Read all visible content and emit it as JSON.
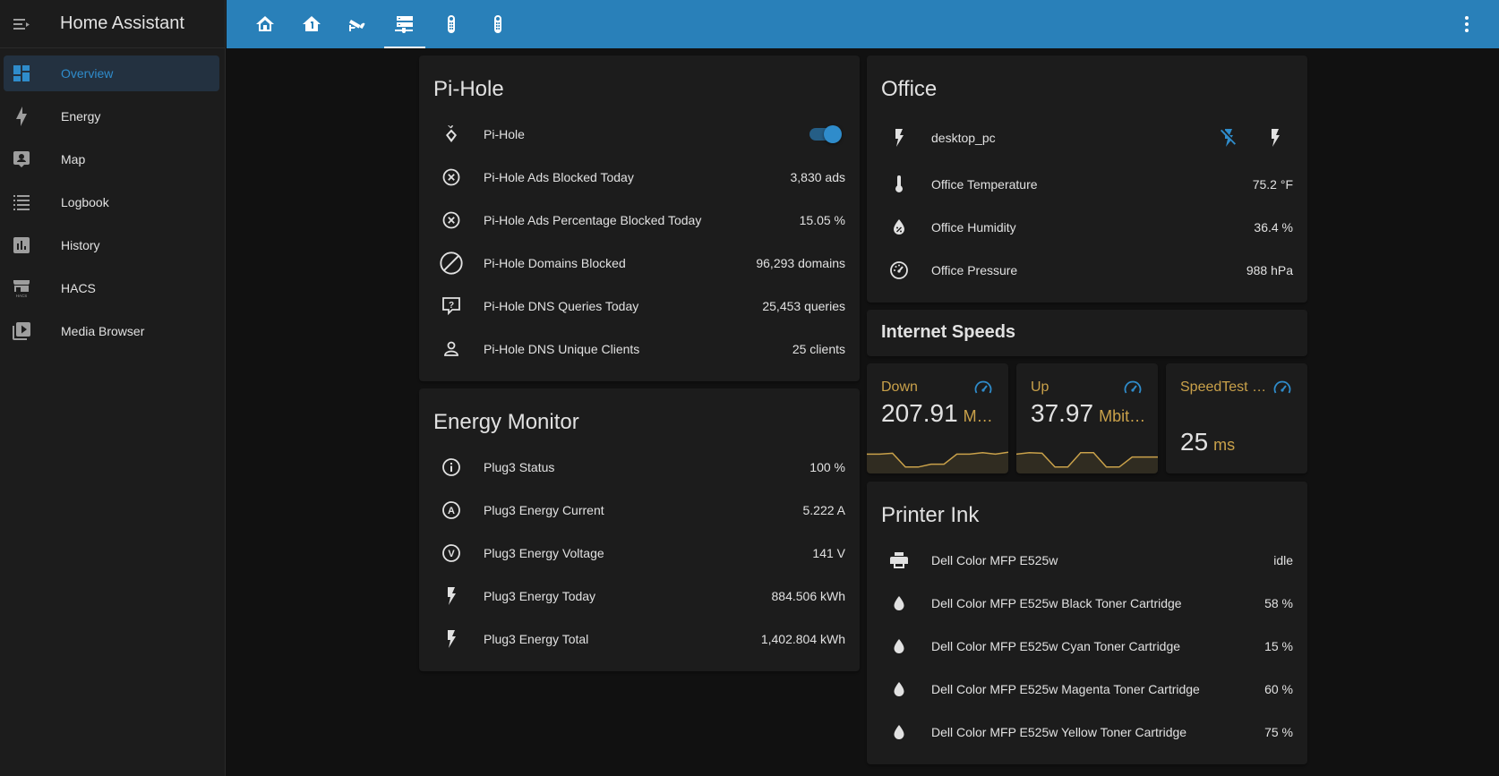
{
  "app": {
    "title": "Home Assistant"
  },
  "sidebar": {
    "items": [
      {
        "label": "Overview",
        "icon": "view-dashboard-icon",
        "active": true
      },
      {
        "label": "Energy",
        "icon": "lightning-bolt-icon"
      },
      {
        "label": "Map",
        "icon": "account-box-icon"
      },
      {
        "label": "Logbook",
        "icon": "format-list-bulleted-icon"
      },
      {
        "label": "History",
        "icon": "chart-box-icon"
      },
      {
        "label": "HACS",
        "icon": "hacs-icon"
      },
      {
        "label": "Media Browser",
        "icon": "play-box-multiple-icon"
      }
    ]
  },
  "topbar": {
    "tabs": [
      {
        "icon": "home-icon"
      },
      {
        "icon": "home-floor-1-icon"
      },
      {
        "icon": "cctv-icon"
      },
      {
        "icon": "server-network-icon",
        "active": true
      },
      {
        "icon": "remote-icon"
      },
      {
        "icon": "remote-icon"
      }
    ],
    "menu_icon": "dots-vertical-icon"
  },
  "pihole": {
    "title": "Pi-Hole",
    "rows": [
      {
        "name": "Pi-Hole",
        "value": "",
        "icon": "pi-hole-icon",
        "toggle_on": true
      },
      {
        "name": "Pi-Hole Ads Blocked Today",
        "value": "3,830 ads",
        "icon": "close-circle-outline-icon"
      },
      {
        "name": "Pi-Hole Ads Percentage Blocked Today",
        "value": "15.05 %",
        "icon": "close-circle-outline-icon"
      },
      {
        "name": "Pi-Hole Domains Blocked",
        "value": "96,293 domains",
        "icon": "block-helper-icon"
      },
      {
        "name": "Pi-Hole DNS Queries Today",
        "value": "25,453 queries",
        "icon": "comment-question-outline-icon"
      },
      {
        "name": "Pi-Hole DNS Unique Clients",
        "value": "25 clients",
        "icon": "account-outline-icon"
      }
    ]
  },
  "energy_monitor": {
    "title": "Energy Monitor",
    "rows": [
      {
        "name": "Plug3 Status",
        "value": "100 %",
        "icon": "information-outline-icon"
      },
      {
        "name": "Plug3 Energy Current",
        "value": "5.222 A",
        "icon": "alpha-a-circle-outline-icon"
      },
      {
        "name": "Plug3 Energy Voltage",
        "value": "141 V",
        "icon": "alpha-v-circle-outline-icon"
      },
      {
        "name": "Plug3 Energy Today",
        "value": "884.506 kWh",
        "icon": "flash-icon"
      },
      {
        "name": "Plug3 Energy Total",
        "value": "1,402.804 kWh",
        "icon": "flash-icon"
      }
    ]
  },
  "office": {
    "title": "Office",
    "rows": [
      {
        "name": "desktop_pc",
        "value": "",
        "icon": "flash-icon",
        "actions": [
          "flash-off-icon",
          "flash-icon"
        ]
      },
      {
        "name": "Office Temperature",
        "value": "75.2 °F",
        "icon": "thermometer-icon"
      },
      {
        "name": "Office Humidity",
        "value": "36.4 %",
        "icon": "water-percent-icon"
      },
      {
        "name": "Office Pressure",
        "value": "988 hPa",
        "icon": "gauge-icon"
      }
    ]
  },
  "internet_speeds": {
    "title": "Internet Speeds",
    "stats": [
      {
        "name": "Down",
        "value": "207.91",
        "unit": "M…",
        "icon": "speedometer-icon",
        "spark": [
          0.55,
          0.55,
          0.58,
          0.1,
          0.1,
          0.2,
          0.2,
          0.55,
          0.55,
          0.6,
          0.55,
          0.62
        ]
      },
      {
        "name": "Up",
        "value": "37.97",
        "unit": "Mbit…",
        "icon": "speedometer-icon",
        "spark": [
          0.55,
          0.6,
          0.58,
          0.1,
          0.1,
          0.6,
          0.6,
          0.1,
          0.1,
          0.45,
          0.45,
          0.45
        ]
      },
      {
        "name": "SpeedTest P…",
        "value": "25",
        "unit": "ms",
        "icon": "speedometer-icon",
        "spark": []
      }
    ]
  },
  "printer_ink": {
    "title": "Printer Ink",
    "rows": [
      {
        "name": "Dell Color MFP E525w",
        "value": "idle",
        "icon": "printer-icon"
      },
      {
        "name": "Dell Color MFP E525w Black Toner Cartridge",
        "value": "58 %",
        "icon": "water-icon"
      },
      {
        "name": "Dell Color MFP E525w Cyan Toner Cartridge",
        "value": "15 %",
        "icon": "water-icon"
      },
      {
        "name": "Dell Color MFP E525w Magenta Toner Cartridge",
        "value": "60 %",
        "icon": "water-icon"
      },
      {
        "name": "Dell Color MFP E525w Yellow Toner Cartridge",
        "value": "75 %",
        "icon": "water-icon"
      }
    ]
  },
  "colors": {
    "accent": "#2980b9",
    "active_text": "#2f8ccb",
    "stat_gold": "#c9a14a"
  }
}
